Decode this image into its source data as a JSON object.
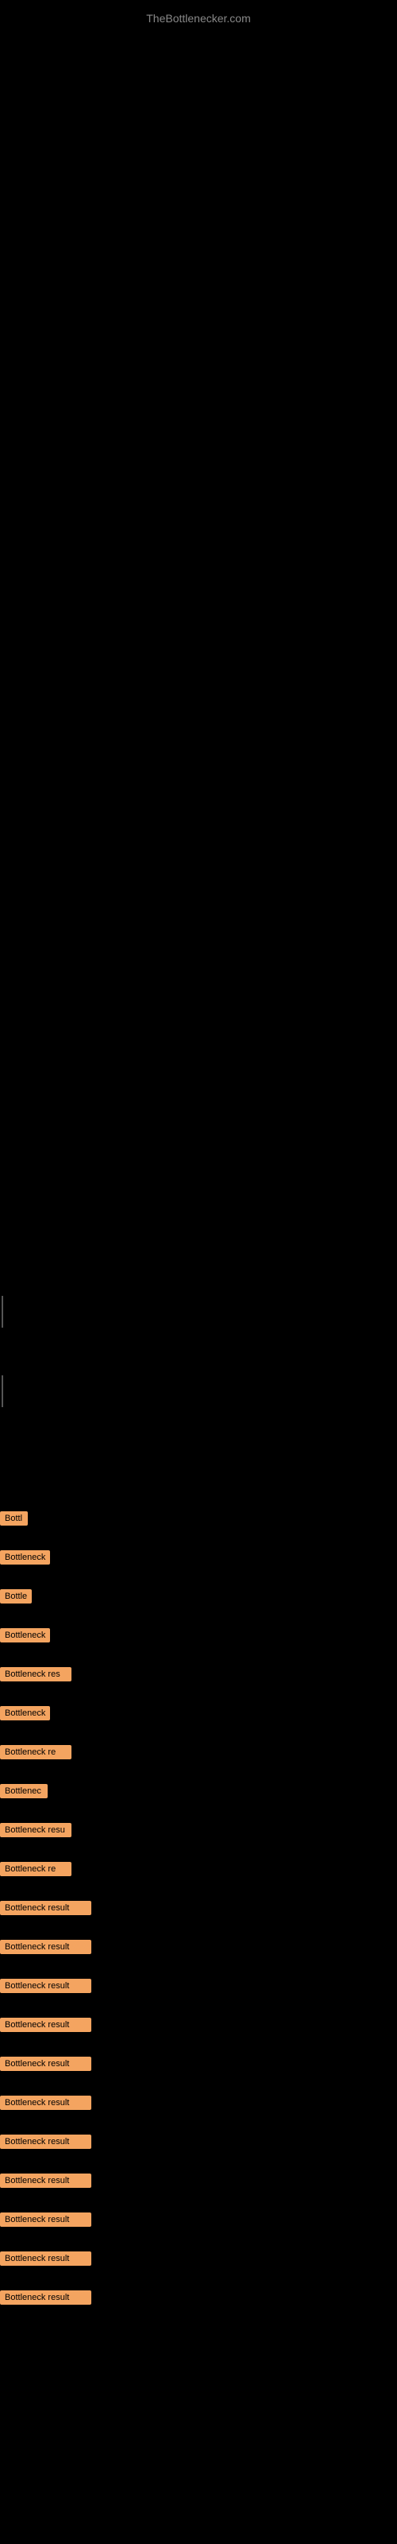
{
  "site": {
    "title": "TheBottlenecker.com"
  },
  "items": [
    {
      "id": 1,
      "label": "Bottl",
      "width_class": "w-short"
    },
    {
      "id": 2,
      "label": "Bottleneck",
      "width_class": "w-medium"
    },
    {
      "id": 3,
      "label": "Bottle",
      "width_class": "w-short"
    },
    {
      "id": 4,
      "label": "Bottleneck",
      "width_class": "w-medium"
    },
    {
      "id": 5,
      "label": "Bottleneck res",
      "width_class": "w-long"
    },
    {
      "id": 6,
      "label": "Bottleneck",
      "width_class": "w-medium"
    },
    {
      "id": 7,
      "label": "Bottleneck re",
      "width_class": "w-long"
    },
    {
      "id": 8,
      "label": "Bottlenec",
      "width_class": "w-medium"
    },
    {
      "id": 9,
      "label": "Bottleneck resu",
      "width_class": "w-long"
    },
    {
      "id": 10,
      "label": "Bottleneck re",
      "width_class": "w-long"
    },
    {
      "id": 11,
      "label": "Bottleneck result",
      "width_class": "w-full"
    },
    {
      "id": 12,
      "label": "Bottleneck result",
      "width_class": "w-full"
    },
    {
      "id": 13,
      "label": "Bottleneck result",
      "width_class": "w-full"
    },
    {
      "id": 14,
      "label": "Bottleneck result",
      "width_class": "w-full"
    },
    {
      "id": 15,
      "label": "Bottleneck result",
      "width_class": "w-full"
    },
    {
      "id": 16,
      "label": "Bottleneck result",
      "width_class": "w-full"
    },
    {
      "id": 17,
      "label": "Bottleneck result",
      "width_class": "w-full"
    },
    {
      "id": 18,
      "label": "Bottleneck result",
      "width_class": "w-full"
    },
    {
      "id": 19,
      "label": "Bottleneck result",
      "width_class": "w-full"
    },
    {
      "id": 20,
      "label": "Bottleneck result",
      "width_class": "w-full"
    },
    {
      "id": 21,
      "label": "Bottleneck result",
      "width_class": "w-full"
    }
  ],
  "colors": {
    "background": "#000000",
    "badge_bg": "#F4A460",
    "badge_text": "#000000",
    "site_title": "#888888"
  }
}
